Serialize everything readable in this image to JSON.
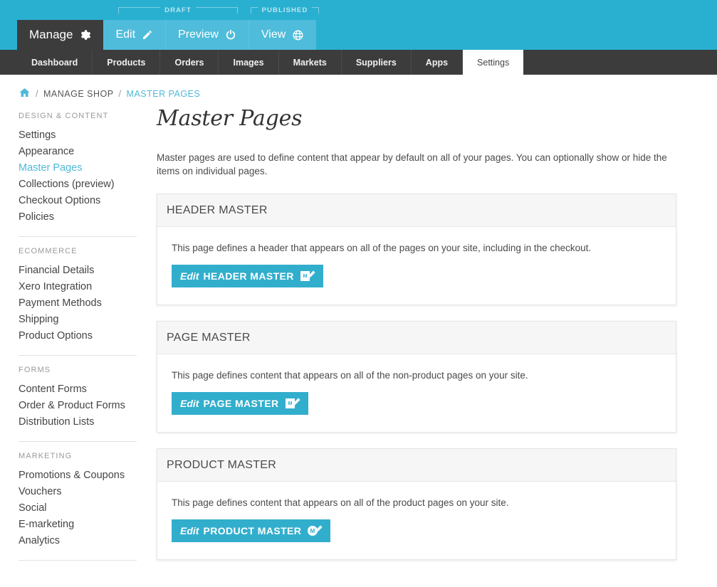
{
  "topbar": {
    "brackets": [
      {
        "label": "DRAFT",
        "name": "draft"
      },
      {
        "label": "PUBLISHED",
        "name": "published"
      }
    ],
    "tabs": [
      {
        "label": "Manage",
        "icon": "gear-icon",
        "state": "active"
      },
      {
        "label": "Edit",
        "icon": "pencil-icon",
        "state": "normal"
      },
      {
        "label": "Preview",
        "icon": "power-icon",
        "state": "normal"
      },
      {
        "label": "View",
        "icon": "globe-icon",
        "state": "normal"
      }
    ]
  },
  "nav": {
    "items": [
      {
        "label": "Dashboard",
        "active": false
      },
      {
        "label": "Products",
        "active": false
      },
      {
        "label": "Orders",
        "active": false
      },
      {
        "label": "Images",
        "active": false
      },
      {
        "label": "Markets",
        "active": false
      },
      {
        "label": "Suppliers",
        "active": false
      },
      {
        "label": "Apps",
        "active": false
      },
      {
        "label": "Settings",
        "active": true
      }
    ]
  },
  "breadcrumb": {
    "home_icon": "home-icon",
    "sep": "/",
    "items": [
      {
        "label": "MANAGE SHOP",
        "current": false
      },
      {
        "label": "MASTER PAGES",
        "current": true
      }
    ]
  },
  "sidebar": {
    "sections": [
      {
        "title": "DESIGN & CONTENT",
        "items": [
          {
            "label": "Settings",
            "active": false
          },
          {
            "label": "Appearance",
            "active": false
          },
          {
            "label": "Master Pages",
            "active": true
          },
          {
            "label": "Collections (preview)",
            "active": false
          },
          {
            "label": "Checkout Options",
            "active": false
          },
          {
            "label": "Policies",
            "active": false
          }
        ]
      },
      {
        "title": "ECOMMERCE",
        "items": [
          {
            "label": "Financial Details",
            "active": false
          },
          {
            "label": "Xero Integration",
            "active": false
          },
          {
            "label": "Payment Methods",
            "active": false
          },
          {
            "label": "Shipping",
            "active": false
          },
          {
            "label": "Product Options",
            "active": false
          }
        ]
      },
      {
        "title": "FORMS",
        "items": [
          {
            "label": "Content Forms",
            "active": false
          },
          {
            "label": "Order & Product Forms",
            "active": false
          },
          {
            "label": "Distribution Lists",
            "active": false
          }
        ]
      },
      {
        "title": "MARKETING",
        "items": [
          {
            "label": "Promotions & Coupons",
            "active": false
          },
          {
            "label": "Vouchers",
            "active": false
          },
          {
            "label": "Social",
            "active": false
          },
          {
            "label": "E-marketing",
            "active": false
          },
          {
            "label": "Analytics",
            "active": false
          }
        ]
      }
    ]
  },
  "main": {
    "title": "Master Pages",
    "intro": "Master pages are used to define content that appear by default on all of your pages. You can optionally show or hide the items on individual pages.",
    "panels": [
      {
        "heading": "HEADER MASTER",
        "text": "This page defines a header that appears on all of the pages on your site, including in the checkout.",
        "button_prefix": "Edit",
        "button_label": "HEADER MASTER",
        "button_icon": "edit-page-icon"
      },
      {
        "heading": "PAGE MASTER",
        "text": "This page defines content that appears on all of the non-product pages on your site.",
        "button_prefix": "Edit",
        "button_label": "PAGE MASTER",
        "button_icon": "edit-page-icon"
      },
      {
        "heading": "PRODUCT MASTER",
        "text": "This page defines content that appears on all of the product pages on your site.",
        "button_prefix": "Edit",
        "button_label": "PRODUCT MASTER",
        "button_icon": "edit-product-icon"
      }
    ]
  },
  "colors": {
    "brand_cyan": "#29b0d1",
    "button_cyan": "#32aecd",
    "dark_nav": "#3c3c3c",
    "link_active": "#4fb8d8",
    "panel_head": "#f6f6f6"
  }
}
